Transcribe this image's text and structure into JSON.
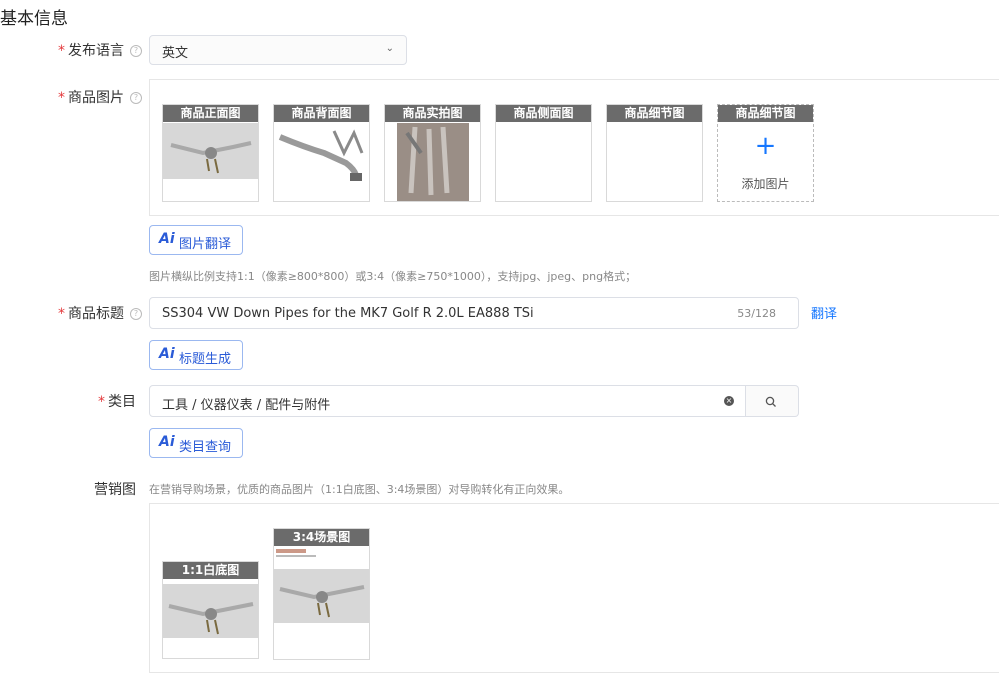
{
  "section_title": "基本信息",
  "required_mark": "*",
  "help_glyph": "?",
  "publish_language": {
    "label": "发布语言",
    "value": "英文",
    "chevron": "chevron-down-icon"
  },
  "product_images": {
    "label": "商品图片",
    "slots": [
      "商品正面图",
      "商品背面图",
      "商品实拍图",
      "商品侧面图",
      "商品细节图",
      "商品细节图"
    ],
    "add_plus": "+",
    "add_label": "添加图片",
    "ai_mark": "Ai",
    "ai_button": "图片翻译",
    "hint": "图片横纵比例支持1:1（像素≥800*800）或3:4（像素≥750*1000），支持jpg、jpeg、png格式；"
  },
  "product_title": {
    "label": "商品标题",
    "value": "SS304 VW Down Pipes for the MK7 Golf R 2.0L EA888 TSi",
    "count": "53/128",
    "translate_link": "翻译",
    "ai_button": "标题生成"
  },
  "category": {
    "label": "类目",
    "value": "工具 / 仪器仪表 / 配件与附件",
    "clear_glyph": "×",
    "search_glyph": "⌕",
    "ai_button": "类目查询"
  },
  "marketing": {
    "label": "营销图",
    "hint": "在营销导购场景，优质的商品图片（1:1白底图、3:4场景图）对导购转化有正向效果。",
    "images": [
      "1:1白底图",
      "3:4场景图"
    ]
  },
  "colors": {
    "accent": "#1677ff",
    "required": "#e4393c",
    "caption_bg": "#6b6b6b"
  }
}
